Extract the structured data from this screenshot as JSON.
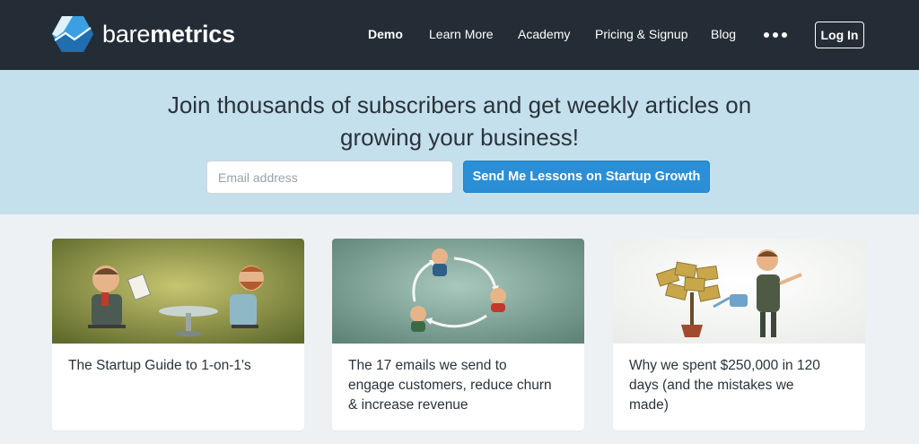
{
  "header": {
    "logo": {
      "brand_light": "bare",
      "brand_bold": "metrics",
      "icon": "baremetrics-hexagon-logo"
    },
    "nav": [
      {
        "label": "Demo",
        "bold": true
      },
      {
        "label": "Learn More",
        "bold": false
      },
      {
        "label": "Academy",
        "bold": false
      },
      {
        "label": "Pricing & Signup",
        "bold": false
      },
      {
        "label": "Blog",
        "bold": false
      }
    ],
    "more_icon": "ellipsis-icon",
    "login_label": "Log In"
  },
  "subscribe": {
    "title_line1": "Join thousands of subscribers and get weekly articles on",
    "title_line2": "growing your business!",
    "email_placeholder": "Email address",
    "button_label": "Send Me Lessons on Startup Growth"
  },
  "cards": [
    {
      "title": "The Startup Guide to 1-on-1's",
      "image": "two-men-meeting-illustration"
    },
    {
      "title": "The 17 emails we send to engage customers, reduce churn & increase revenue",
      "image": "three-people-cycle-arrows-illustration"
    },
    {
      "title": "Why we spent $250,000 in 120 days (and the mistakes we made)",
      "image": "man-watering-money-tree-illustration"
    }
  ],
  "colors": {
    "header_bg": "#242d35",
    "band_bg": "#c4e0ec",
    "page_bg": "#eef1f4",
    "cta": "#2a8fd6"
  }
}
